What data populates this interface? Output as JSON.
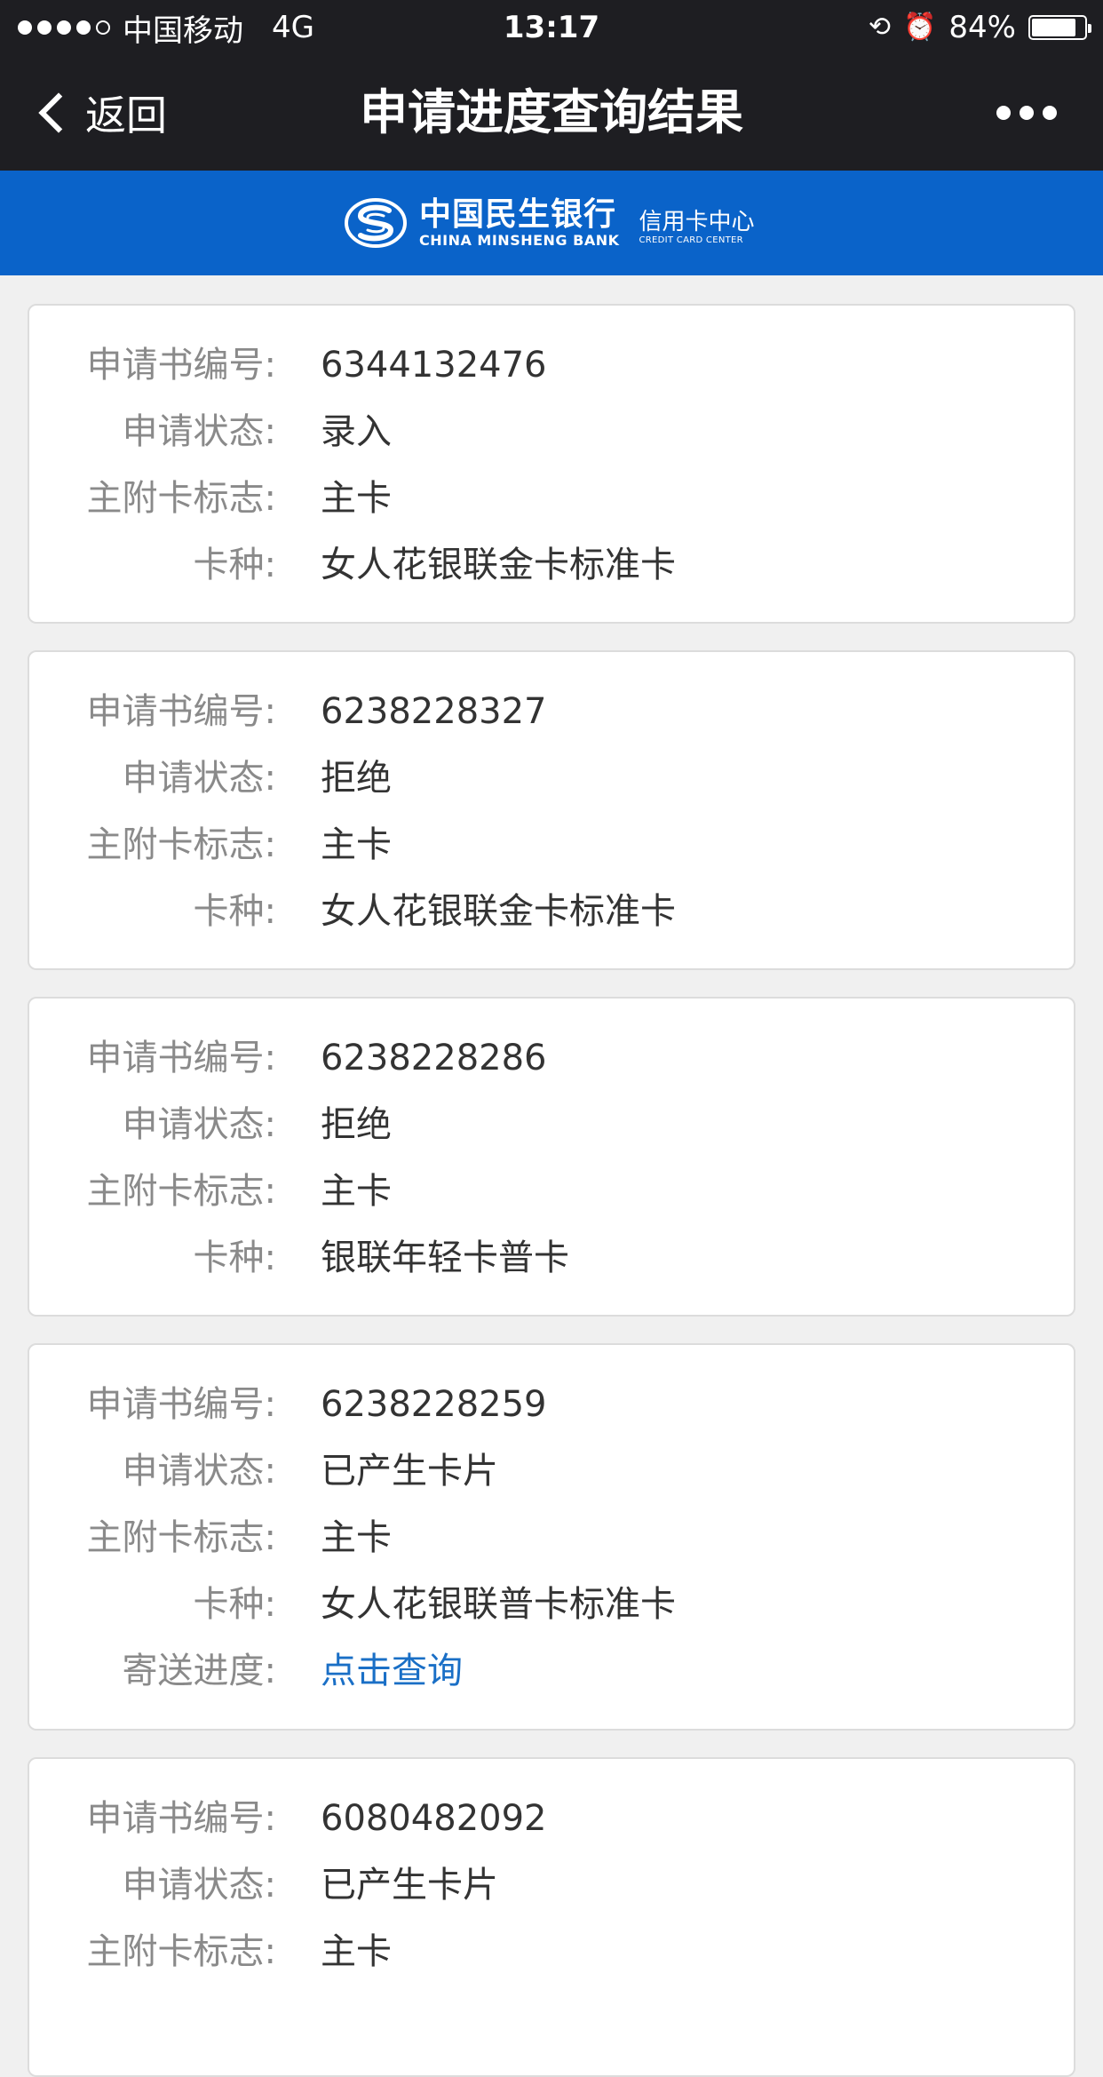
{
  "status_bar": {
    "carrier": "中国移动",
    "network": "4G",
    "time": "13:17",
    "battery": "84%",
    "battery_level": 0.84,
    "signal_bars": 4
  },
  "nav": {
    "back_label": "返回",
    "title": "申请进度查询结果"
  },
  "banner": {
    "bank_cn": "中国民生银行",
    "bank_en": "CHINA MINSHENG BANK",
    "center_cn": "信用卡中心",
    "center_en": "CREDIT CARD CENTER",
    "color": "#0a63c9"
  },
  "labels": {
    "app_no": "申请书编号:",
    "status": "申请状态:",
    "card_flag": "主附卡标志:",
    "card_type": "卡种:",
    "delivery": "寄送进度:"
  },
  "applications": [
    {
      "app_no": "6344132476",
      "status": "录入",
      "card_flag": "主卡",
      "card_type": "女人花银联金卡标准卡"
    },
    {
      "app_no": "6238228327",
      "status": "拒绝",
      "card_flag": "主卡",
      "card_type": "女人花银联金卡标准卡"
    },
    {
      "app_no": "6238228286",
      "status": "拒绝",
      "card_flag": "主卡",
      "card_type": "银联年轻卡普卡"
    },
    {
      "app_no": "6238228259",
      "status": "已产生卡片",
      "card_flag": "主卡",
      "card_type": "女人花银联普卡标准卡",
      "delivery": "点击查询"
    },
    {
      "app_no": "6080482092",
      "status": "已产生卡片",
      "card_flag": "主卡"
    }
  ]
}
